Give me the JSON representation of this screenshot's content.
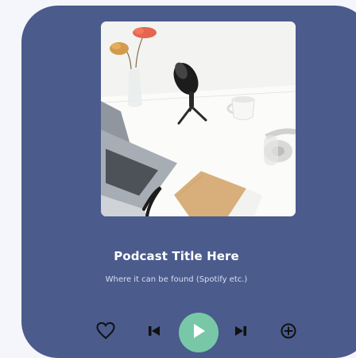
{
  "podcast": {
    "title": "Podcast Title Here",
    "subtitle": "Where it can be found (Spotify etc.)"
  },
  "cover": {
    "alt": "Desk with podcast microphone, laptop, headphones, cup and notebook"
  },
  "controls": {
    "like_icon": "heart-icon",
    "previous_icon": "skip-previous-icon",
    "play_icon": "play-icon",
    "next_icon": "skip-next-icon",
    "add_icon": "plus-circle-icon"
  },
  "colors": {
    "card_background": "#4a5b8c",
    "page_background": "#f5f6fc",
    "play_button": "#78c8a8",
    "text_primary": "#ffffff",
    "text_secondary": "#dfe5f4"
  }
}
